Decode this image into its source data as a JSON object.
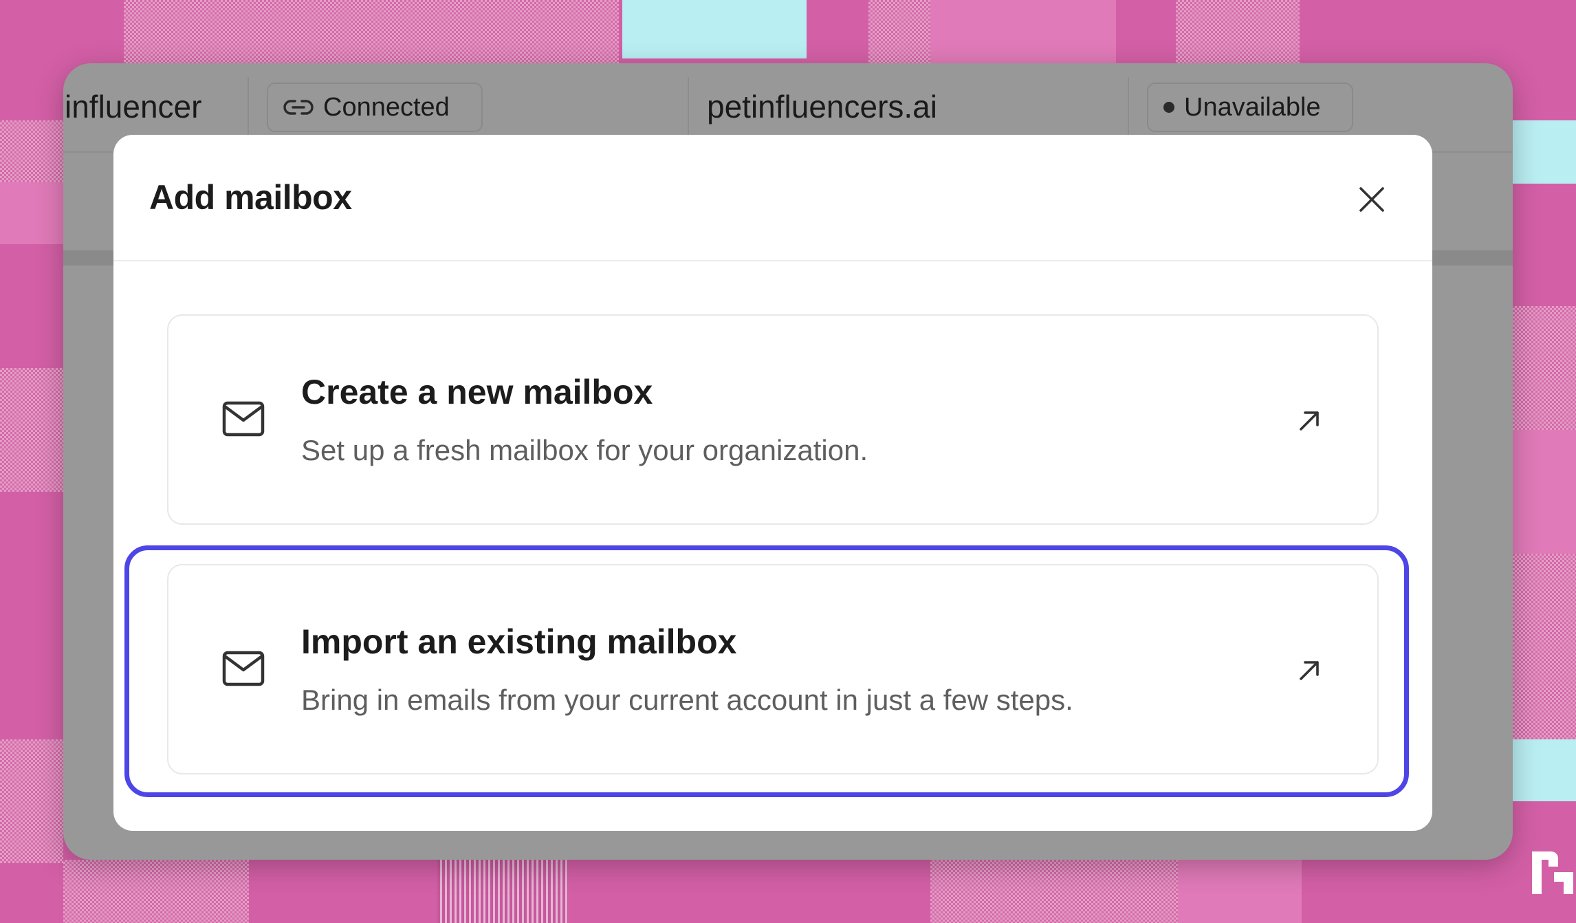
{
  "background_row": {
    "name_partial": "influencer",
    "connection_status": "Connected",
    "domain": "petinfluencers.ai",
    "availability": "Unavailable"
  },
  "modal": {
    "title": "Add mailbox",
    "options": [
      {
        "title": "Create a new mailbox",
        "description": "Set up a fresh mailbox for your organization."
      },
      {
        "title": "Import an existing mailbox",
        "description": "Bring in emails from your current account in just a few steps."
      }
    ],
    "focused_option_index": 1
  },
  "icons": {
    "connected": "link-icon",
    "availability": "status-dot-icon",
    "close": "close-icon",
    "option": "mail-icon",
    "option_action": "arrow-up-right-icon"
  },
  "colors": {
    "focus_ring": "#4d45e6",
    "overlay": "#989898",
    "backdrop": "#c7589c"
  }
}
